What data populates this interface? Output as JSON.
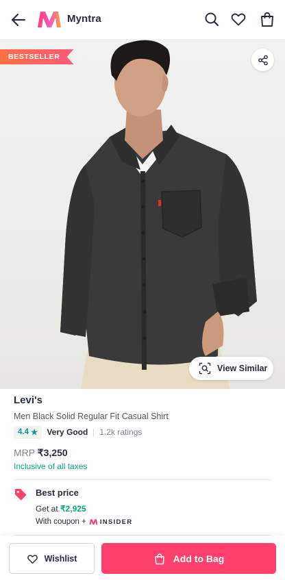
{
  "header": {
    "brand_name": "Myntra",
    "icons": [
      "back-arrow-icon",
      "myntra-logo",
      "search-icon",
      "heart-icon",
      "bag-icon"
    ]
  },
  "hero": {
    "badge": "BESTSELLER",
    "view_similar_label": "View Similar",
    "icons": [
      "share-icon",
      "visual-search-icon"
    ]
  },
  "product": {
    "brand": "Levi's",
    "name": "Men Black Solid Regular Fit Casual Shirt",
    "rating": "4.4",
    "rating_label": "Very Good",
    "ratings_count": "1.2k ratings",
    "mrp_label": "MRP",
    "price": "₹3,250",
    "tax_note": "Inclusive of all taxes"
  },
  "offer": {
    "title": "Best price",
    "get_at_label": "Get at",
    "best_price": "₹2,925",
    "coupon_text": "With coupon +",
    "program": "INSIDER"
  },
  "actions": {
    "wishlist_label": "Wishlist",
    "add_to_bag_label": "Add to Bag"
  },
  "colors": {
    "accent": "#ff3f6c",
    "green": "#03a685",
    "rating_green": "#14958f",
    "badge_orange": "#ff7043"
  }
}
